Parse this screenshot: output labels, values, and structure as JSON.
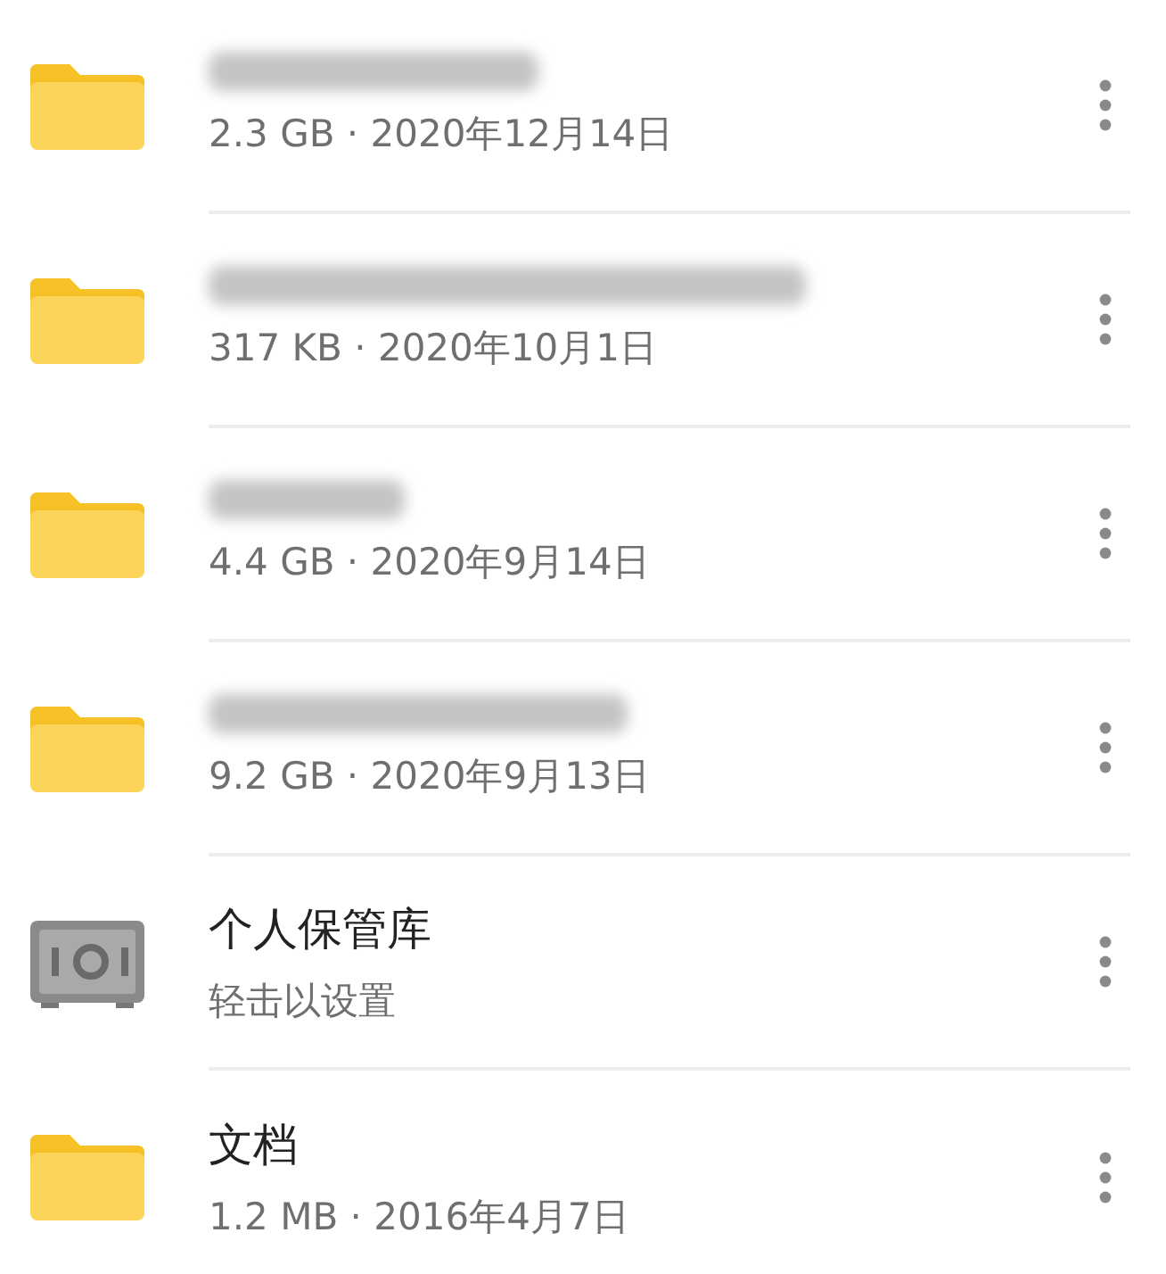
{
  "files": [
    {
      "kind": "folder",
      "name_hidden": true,
      "details": "2.3 GB · 2020年12月14日"
    },
    {
      "kind": "folder",
      "name_hidden": true,
      "details": "317 KB · 2020年10月1日"
    },
    {
      "kind": "folder",
      "name_hidden": true,
      "details": "4.4 GB · 2020年9月14日"
    },
    {
      "kind": "folder",
      "name_hidden": true,
      "details": "9.2 GB · 2020年9月13日"
    },
    {
      "kind": "vault",
      "name_hidden": false,
      "name": "个人保管库",
      "details": "轻击以设置"
    },
    {
      "kind": "folder",
      "name_hidden": false,
      "name": "文档",
      "details": "1.2 MB · 2016年4月7日"
    }
  ]
}
